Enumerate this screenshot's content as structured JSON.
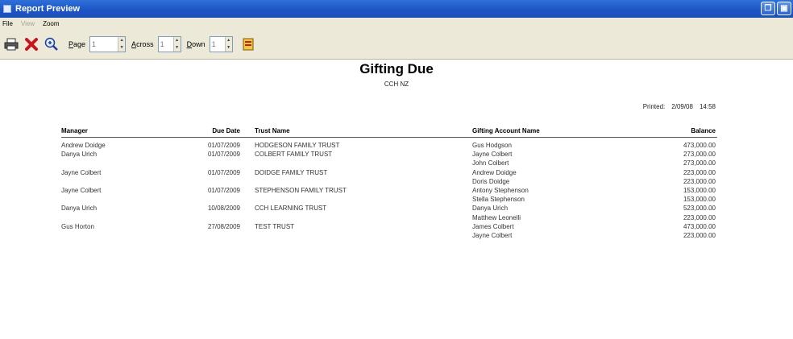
{
  "window": {
    "title": "Report Preview"
  },
  "menu": {
    "file": "File",
    "view": "View",
    "zoom": "Zoom"
  },
  "toolbar": {
    "page_label": "Page",
    "page_value": "1",
    "across_label": "Across",
    "across_value": "1",
    "down_label": "Down",
    "down_value": "1"
  },
  "report": {
    "title": "Gifting Due",
    "subtitle": "CCH NZ",
    "printed_label": "Printed:",
    "printed_date": "2/09/08",
    "printed_time": "14:58",
    "columns": {
      "manager": "Manager",
      "due_date": "Due Date",
      "trust_name": "Trust Name",
      "account_name": "Gifting Account Name",
      "balance": "Balance"
    },
    "rows": [
      {
        "manager": "Andrew Doidge",
        "due_date": "01/07/2009",
        "trust": "HODGESON FAMILY TRUST",
        "account": "Gus Hodgson",
        "balance": "473,000.00"
      },
      {
        "manager": "Danya Urich",
        "due_date": "01/07/2009",
        "trust": "COLBERT FAMILY TRUST",
        "account": "Jayne Colbert",
        "balance": "273,000.00"
      },
      {
        "manager": "",
        "due_date": "",
        "trust": "",
        "account": "John Colbert",
        "balance": "273,000.00"
      },
      {
        "manager": "Jayne Colbert",
        "due_date": "01/07/2009",
        "trust": "DOIDGE FAMILY TRUST",
        "account": "Andrew Doidge",
        "balance": "223,000.00"
      },
      {
        "manager": "",
        "due_date": "",
        "trust": "",
        "account": "Doris Doidge",
        "balance": "223,000.00"
      },
      {
        "manager": "Jayne Colbert",
        "due_date": "01/07/2009",
        "trust": "STEPHENSON FAMILY TRUST",
        "account": "Antony Stephenson",
        "balance": "153,000.00"
      },
      {
        "manager": "",
        "due_date": "",
        "trust": "",
        "account": "Stella Stephenson",
        "balance": "153,000.00"
      },
      {
        "manager": "Danya Urich",
        "due_date": "10/08/2009",
        "trust": "CCH LEARNING TRUST",
        "account": "Danya Urich",
        "balance": "523,000.00"
      },
      {
        "manager": "",
        "due_date": "",
        "trust": "",
        "account": "Matthew Leonelli",
        "balance": "223,000.00"
      },
      {
        "manager": "Gus Horton",
        "due_date": "27/08/2009",
        "trust": "TEST TRUST",
        "account": "James Colbert",
        "balance": "473,000.00"
      },
      {
        "manager": "",
        "due_date": "",
        "trust": "",
        "account": "Jayne Colbert",
        "balance": "223,000.00"
      }
    ]
  }
}
